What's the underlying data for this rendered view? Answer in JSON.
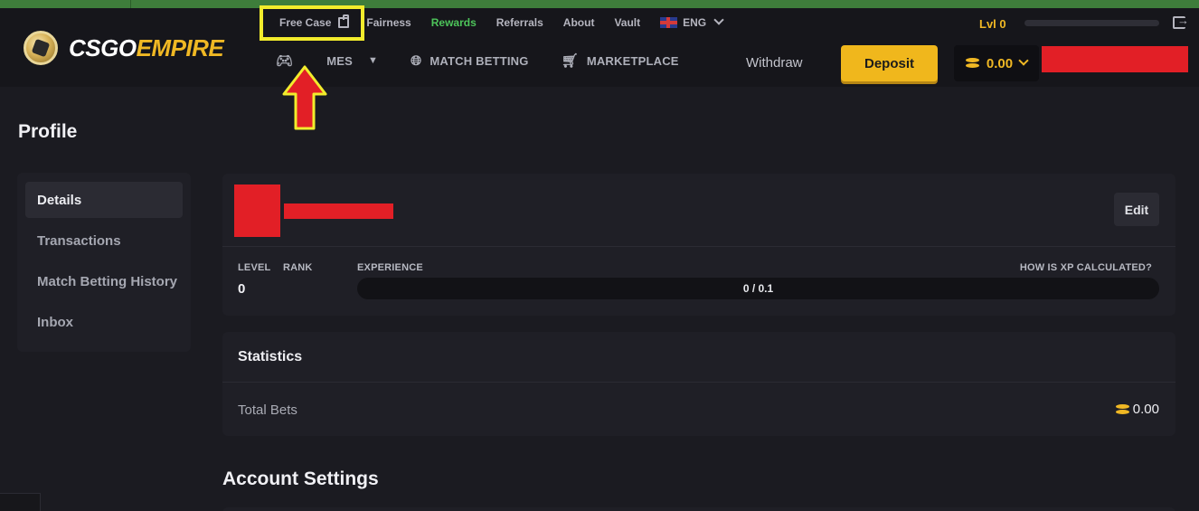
{
  "brand": {
    "logo_white": "CSGO",
    "logo_yellow": "EMPIRE",
    "accent": "#f0b824",
    "highlight": "#f2ec2c",
    "arrow_color": "#e21f26"
  },
  "top_links": {
    "free_case": "Free Case",
    "fairness": "Fairness",
    "rewards": "Rewards",
    "referrals": "Referrals",
    "about": "About",
    "vault": "Vault",
    "language": "ENG"
  },
  "level_indicator": {
    "label": "Lvl 0"
  },
  "main_nav": {
    "games_visible": "MES",
    "match_betting": "MATCH BETTING",
    "marketplace": "MARKETPLACE"
  },
  "actions": {
    "withdraw": "Withdraw",
    "deposit": "Deposit",
    "balance": "0.00"
  },
  "page": {
    "title": "Profile"
  },
  "sidebar": {
    "items": [
      {
        "label": "Details",
        "active": true
      },
      {
        "label": "Transactions",
        "active": false
      },
      {
        "label": "Match Betting History",
        "active": false
      },
      {
        "label": "Inbox",
        "active": false
      }
    ]
  },
  "profile": {
    "edit_label": "Edit",
    "level_label": "LEVEL",
    "rank_label": "RANK",
    "experience_label": "EXPERIENCE",
    "xp_help_label": "HOW IS XP CALCULATED?",
    "level_value": "0",
    "xp_text": "0 / 0.1",
    "xp_progress": 0
  },
  "statistics": {
    "title": "Statistics",
    "total_bets_label": "Total Bets",
    "total_bets_value": "0.00"
  },
  "account_settings": {
    "title": "Account Settings"
  }
}
